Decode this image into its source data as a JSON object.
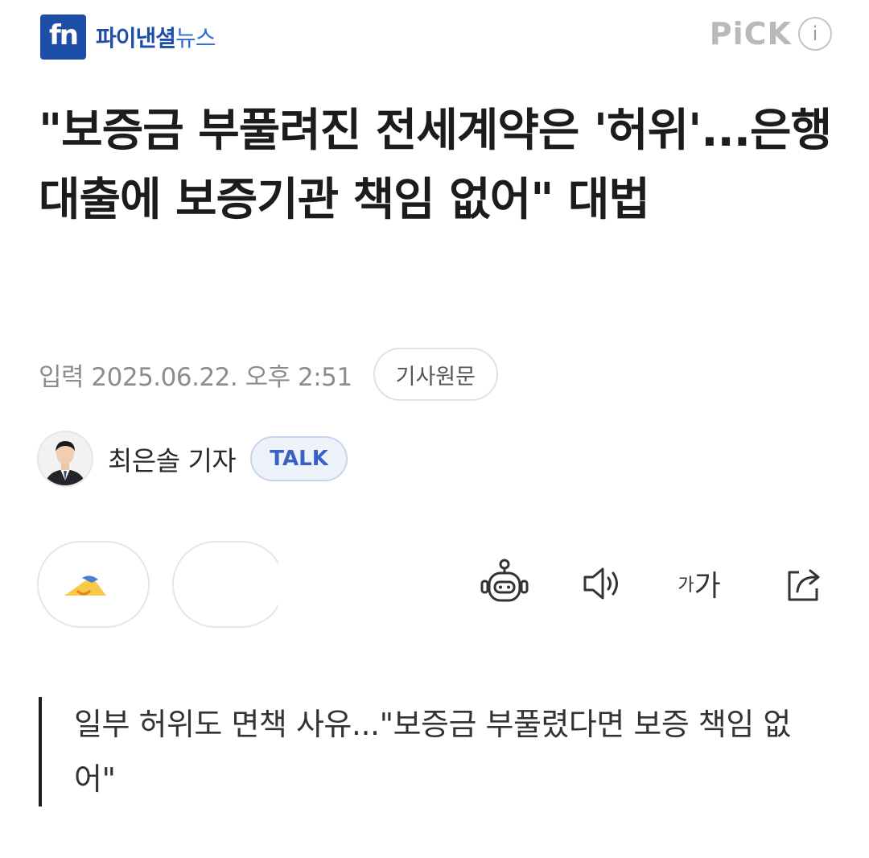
{
  "header": {
    "logo_mark": "fn",
    "logo_name": "파이낸셜",
    "logo_news": "뉴스",
    "pick_label": "PiCK",
    "info_label": "i"
  },
  "article": {
    "title": "\"보증금 부풀려진 전세계약은 '허위'...은행 대출에 보증기관 책임 없어\" 대법",
    "date": "입력 2025.06.22. 오후 2:51",
    "original_button": "기사원문",
    "author_name": "최은솔 기자",
    "talk_label": "TALK",
    "subheading": "일부 허위도 면책 사유...\"보증금 부풀렸다면 보증 책임 없어\""
  },
  "toolbar": {
    "font_small": "가",
    "font_large": "가"
  },
  "colors": {
    "brand": "#1e4fa8",
    "talk_accent": "#3a62c4"
  },
  "icons": [
    "ai-summary-robot-icon",
    "speaker-icon",
    "font-size-icon",
    "share-icon"
  ]
}
